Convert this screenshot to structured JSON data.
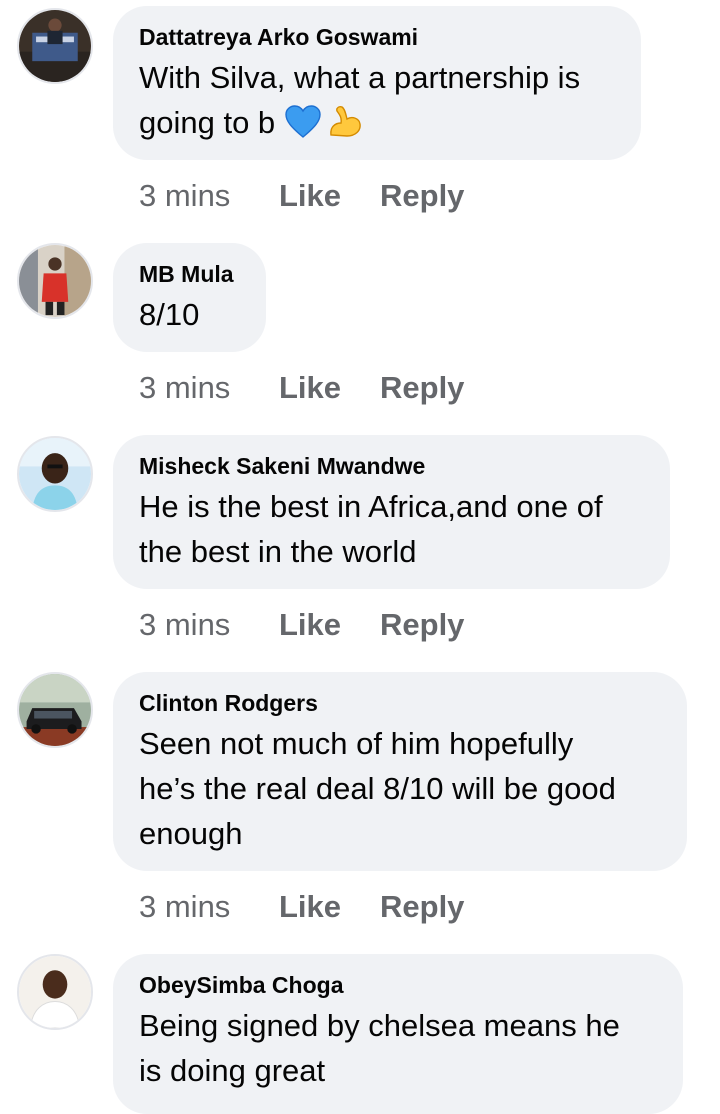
{
  "colors": {
    "bubble_background": "#f0f2f5",
    "meta_text": "#65676b",
    "primary_text": "#050505"
  },
  "comments": [
    {
      "author": "Dattatreya Arko Goswami",
      "text_lines": [
        "With Silva, what a partnership is",
        "going to b"
      ],
      "emojis": [
        "blue-heart-icon",
        "flexed-biceps-icon"
      ],
      "time": "3 mins",
      "like_label": "Like",
      "reply_label": "Reply",
      "avatar_icon": "profile-photo-trophy"
    },
    {
      "author": "MB Mula",
      "text_lines": [
        "8/10"
      ],
      "time": "3 mins",
      "like_label": "Like",
      "reply_label": "Reply",
      "avatar_icon": "profile-photo-red-jacket"
    },
    {
      "author": "Misheck Sakeni Mwandwe",
      "text_lines": [
        "He is the best in Africa,and one of",
        "the best in the world"
      ],
      "time": "3 mins",
      "like_label": "Like",
      "reply_label": "Reply",
      "avatar_icon": "profile-photo-selfie"
    },
    {
      "author": "Clinton Rodgers",
      "text_lines": [
        "Seen not much of him hopefully",
        "he’s the real deal 8/10 will be good",
        "enough"
      ],
      "time": "3 mins",
      "like_label": "Like",
      "reply_label": "Reply",
      "avatar_icon": "profile-photo-car"
    },
    {
      "author": "ObeySimba Choga",
      "text_lines": [
        "Being signed by chelsea means he",
        "is doing great"
      ],
      "avatar_icon": "profile-photo-portrait"
    }
  ]
}
